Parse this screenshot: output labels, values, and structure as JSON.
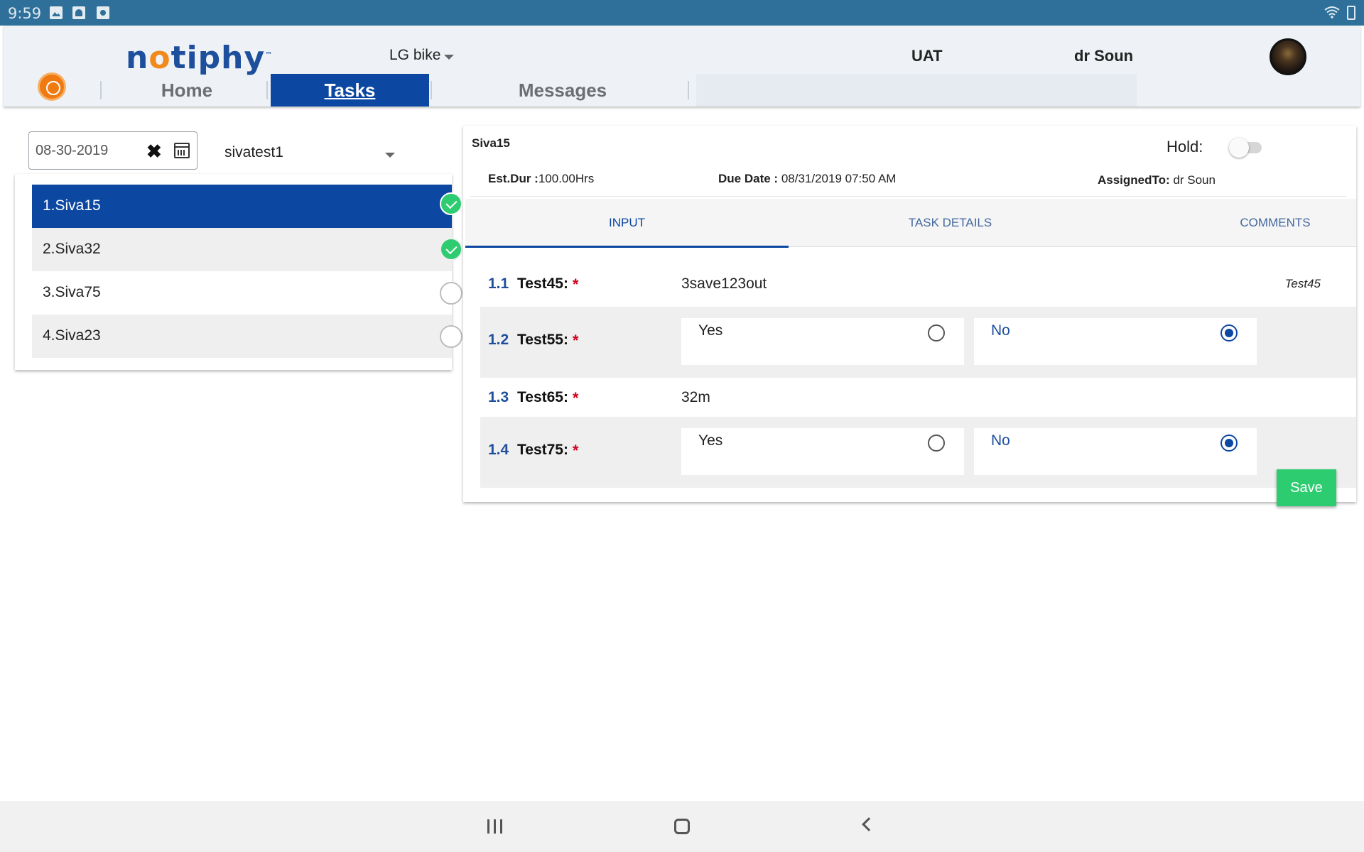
{
  "statusbar": {
    "time": "9:59"
  },
  "header": {
    "logo": {
      "pre": "n",
      "dot": "o",
      "post": "tiphy",
      "mark": "™"
    },
    "company": "LG bike",
    "environment": "UAT",
    "user": "dr Soun",
    "nav": [
      "Home",
      "Tasks",
      "Messages"
    ],
    "active_nav": "Tasks"
  },
  "filters": {
    "date": "08-30-2019",
    "user_select": "sivatest1"
  },
  "tasks": [
    {
      "label": "1.Siva15",
      "done": true,
      "selected": true
    },
    {
      "label": "2.Siva32",
      "done": true,
      "selected": false
    },
    {
      "label": "3.Siva75",
      "done": false,
      "selected": false
    },
    {
      "label": "4.Siva23",
      "done": false,
      "selected": false
    }
  ],
  "detail": {
    "title": "Siva15",
    "hold_label": "Hold:",
    "hold_on": false,
    "est_dur_label": "Est.Dur :",
    "est_dur_value": "100.00Hrs",
    "due_date_label": "Due Date :",
    "due_date_value": "08/31/2019 07:50 AM",
    "assigned_label": "AssignedTo:",
    "assigned_value": "dr Soun",
    "tabs": [
      "INPUT",
      "TASK DETAILS",
      "COMMENTS"
    ],
    "active_tab": "INPUT",
    "questions": [
      {
        "num": "1.1",
        "label": "Test45:",
        "value": "3save123out",
        "hint": "Test45"
      },
      {
        "num": "1.2",
        "label": "Test55:",
        "options": [
          "Yes",
          "No"
        ],
        "selected": "No"
      },
      {
        "num": "1.3",
        "label": "Test65:",
        "value": "32m"
      },
      {
        "num": "1.4",
        "label": "Test75:",
        "options": [
          "Yes",
          "No"
        ],
        "selected": "No"
      }
    ],
    "save_label": "Save",
    "required_mark": "*"
  },
  "colors": {
    "primary": "#0c47a1",
    "success": "#2ecc71",
    "statusbar": "#2e7099",
    "required": "#d0021b"
  }
}
